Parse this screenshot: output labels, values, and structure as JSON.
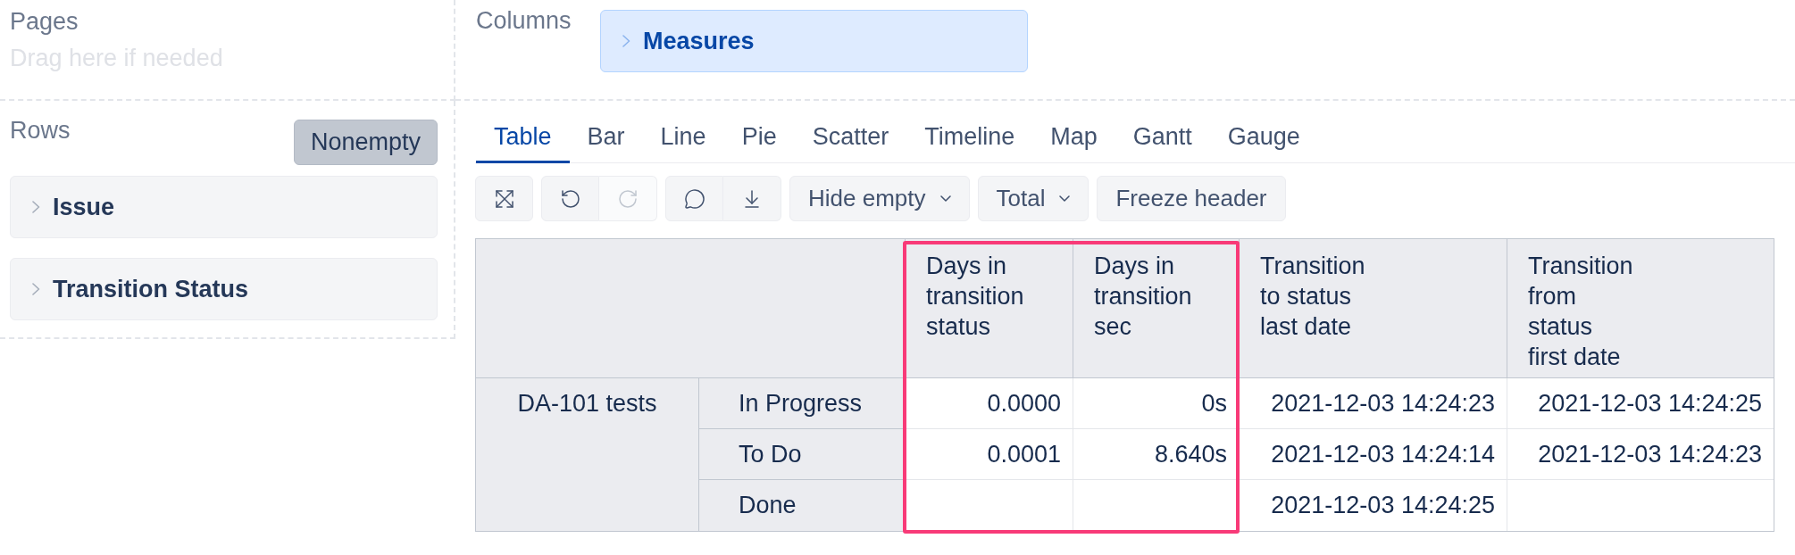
{
  "pages": {
    "label": "Pages",
    "empty_text": "Drag here if needed"
  },
  "columns_area": {
    "label": "Columns",
    "chips": [
      {
        "kind": "measures",
        "label": "Measures",
        "expanded": false
      }
    ]
  },
  "rows_area": {
    "label": "Rows",
    "nonempty_button": {
      "label": "Nonempty",
      "on": true
    },
    "chips": [
      {
        "kind": "dimension",
        "label": "Issue",
        "expanded": false
      },
      {
        "kind": "dimension",
        "label": "Transition Status",
        "expanded": false
      }
    ]
  },
  "view_tabs": [
    {
      "label": "Table",
      "selected": true
    },
    {
      "label": "Bar",
      "selected": false
    },
    {
      "label": "Line",
      "selected": false
    },
    {
      "label": "Pie",
      "selected": false
    },
    {
      "label": "Scatter",
      "selected": false
    },
    {
      "label": "Timeline",
      "selected": false
    },
    {
      "label": "Map",
      "selected": false
    },
    {
      "label": "Gantt",
      "selected": false
    },
    {
      "label": "Gauge",
      "selected": false
    }
  ],
  "toolbar": [
    {
      "kind": "icon-group",
      "buttons": [
        {
          "disabled": false
        }
      ]
    },
    {
      "kind": "icon-group",
      "buttons": [
        {
          "disabled": false
        },
        {
          "disabled": true
        }
      ]
    },
    {
      "kind": "icon-group",
      "buttons": [
        {
          "disabled": false
        },
        {
          "disabled": false
        }
      ]
    },
    {
      "kind": "dropdown",
      "label": "Hide empty"
    },
    {
      "kind": "dropdown",
      "label": "Total"
    },
    {
      "kind": "button",
      "label": "Freeze header"
    }
  ],
  "table": {
    "columns": [
      {
        "label": "Days in transition status",
        "highlighted": true
      },
      {
        "label": "Days in transition sec",
        "highlighted": true
      },
      {
        "label": "Transition to status last date",
        "highlighted": false
      },
      {
        "label": "Transition from status first date",
        "highlighted": false
      }
    ],
    "rows": [
      {
        "issue": "DA-101 tests",
        "statuses": [
          {
            "status": "In Progress",
            "days_in_transition_status": "0.0000",
            "days_in_transition_sec": "0s",
            "transition_to_status_last_date": "2021-12-03 14:24:23",
            "transition_from_status_first_date": "2021-12-03 14:24:25"
          },
          {
            "status": "To Do",
            "days_in_transition_status": "0.0001",
            "days_in_transition_sec": "8.640s",
            "transition_to_status_last_date": "2021-12-03 14:24:14",
            "transition_from_status_first_date": "2021-12-03 14:24:23"
          },
          {
            "status": "Done",
            "transition_to_status_last_date": "2021-12-03 14:24:25"
          }
        ]
      }
    ]
  }
}
